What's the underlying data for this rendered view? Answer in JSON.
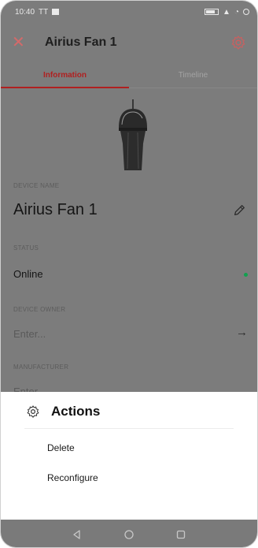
{
  "status_bar": {
    "time": "10:40",
    "extra": "TT"
  },
  "header": {
    "title": "Airius Fan 1"
  },
  "tabs": [
    {
      "label": "Information"
    },
    {
      "label": "Timeline"
    }
  ],
  "fields": {
    "device_name": {
      "label": "DEVICE NAME",
      "value": "Airius Fan 1"
    },
    "status": {
      "label": "STATUS",
      "value": "Online"
    },
    "device_owner": {
      "label": "DEVICE OWNER",
      "placeholder": "Enter..."
    },
    "manufacturer": {
      "label": "MANUFACTURER",
      "placeholder": "Enter"
    }
  },
  "sheet": {
    "title": "Actions",
    "items": [
      {
        "label": "Delete"
      },
      {
        "label": "Reconfigure"
      }
    ]
  },
  "colors": {
    "accent": "#b02020",
    "online": "#12a04f",
    "overlay": "#7c7c7c"
  },
  "icons": {
    "close": "close-icon",
    "settings": "gear-icon",
    "edit": "pencil-icon",
    "arrow": "arrow-right-icon",
    "nav_back": "triangle-back-icon",
    "nav_home": "circle-home-icon",
    "nav_recent": "square-recent-icon"
  }
}
